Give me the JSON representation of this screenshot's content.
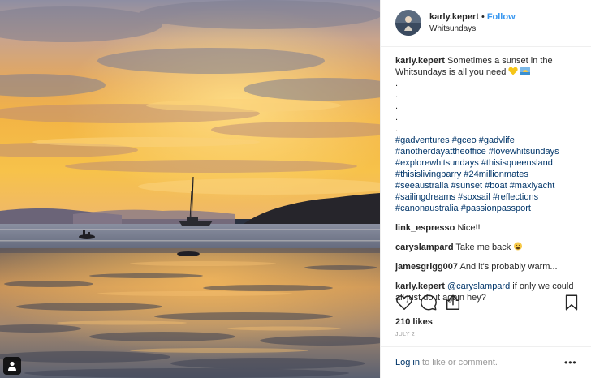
{
  "post": {
    "username": "karly.kepert",
    "separator": "•",
    "follow_label": "Follow",
    "location": "Whitsundays",
    "caption_text": "Sometimes a sunset in the Whitsundays is all you need",
    "caption_dots": [
      ".",
      ".",
      ".",
      ".",
      "."
    ],
    "hashtags": [
      "#gadventures",
      "#gceo",
      "#gadvlife",
      "#anotherdayattheoffice",
      "#lovewhitsundays",
      "#explorewhitsundays",
      "#thisisqueensland",
      "#thisislivingbarry",
      "#24millionmates",
      "#seeaustralia",
      "#sunset",
      "#boat",
      "#maxiyacht",
      "#sailingdreams",
      "#soxsail",
      "#reflections",
      "#canonaustralia",
      "#passionpassport"
    ]
  },
  "comments": [
    {
      "user": "link_espresso",
      "text": "Nice!!"
    },
    {
      "user": "caryslampard",
      "text": "Take me back"
    },
    {
      "user": "jamesgrigg007",
      "text": "And it's probably warm..."
    },
    {
      "user": "karly.kepert",
      "mention": "@caryslampard",
      "text": "if only we could all just do it again hey?"
    }
  ],
  "engagement": {
    "likes": "210 likes",
    "date": "JULY 2"
  },
  "footer": {
    "login_link": "Log in",
    "login_rest": "to like or comment.",
    "more_label": "•••"
  },
  "icons": {
    "like": "heart-icon",
    "comment": "comment-icon",
    "share": "share-icon",
    "save": "bookmark-icon",
    "user_tag": "person-icon"
  },
  "colors": {
    "link_blue": "#3897f0",
    "hashtag": "#003569",
    "muted": "#999999",
    "text": "#262626"
  }
}
